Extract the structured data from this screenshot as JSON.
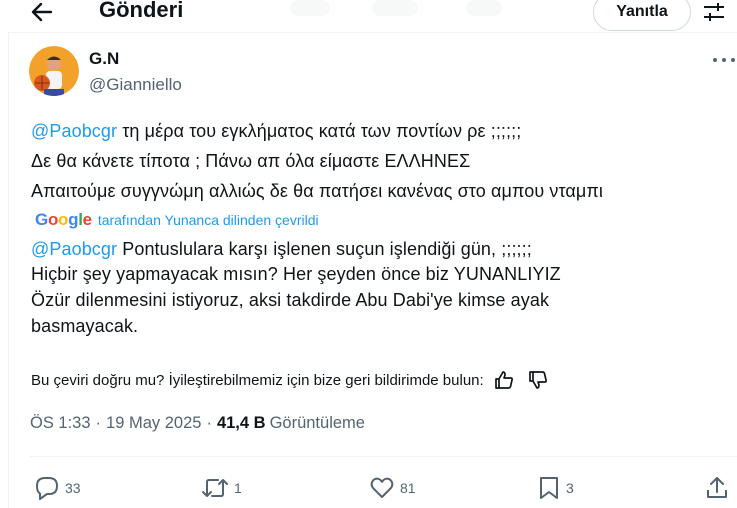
{
  "header": {
    "title": "Gönderi",
    "reply_label": "Yanıtla"
  },
  "author": {
    "display_name": "G.N",
    "handle": "@Gianniello"
  },
  "original": {
    "line1_mention": "@Paobcgr",
    "line1_text": " τη μέρα του εγκλήματος κατά των ποντίων ρε ;;;;;;",
    "line2": "Δε θα κάνετε τίποτα ; Πάνω απ όλα είμαστε ΕΛΛΗΝΕΣ",
    "line3": "Απαιτούμε συγγνώμη αλλιώς δε θα πατήσει κανένας στο αμπου νταμπι"
  },
  "translation": {
    "provider": "Google",
    "label": "tarafından Yunanca dilinden çevrildi",
    "line1_mention": "@Paobcgr",
    "line1_text": " Pontuslulara karşı işlenen suçun işlendiği gün, ;;;;;;",
    "line2": "Hiçbir şey yapmayacak mısın? Her şeyden önce biz YUNANLIYIZ",
    "line3": "Özür dilenmesini istiyoruz, aksi takdirde Abu Dabi'ye kimse ayak",
    "line4": "basmayacak.",
    "feedback": "Bu çeviri doğru mu? İyileştirebilmemiz için bize geri bildirimde bulun:"
  },
  "meta": {
    "time": "ÖS 1:33",
    "date": "19 May 2025",
    "views_count": "41,4 B",
    "views_label": "Görüntüleme",
    "separator": "·"
  },
  "actions": {
    "replies": "33",
    "reposts": "1",
    "likes": "81",
    "bookmarks": "3"
  },
  "icons": {
    "back": "arrow-left-icon",
    "settings": "sliders-icon",
    "more": "more-horizontal-icon",
    "reply": "speech-bubble-icon",
    "repost": "repost-icon",
    "like": "heart-icon",
    "bookmark": "bookmark-icon",
    "share": "share-icon",
    "thumbs_up": "thumbs-up-icon",
    "thumbs_down": "thumbs-down-icon"
  },
  "colors": {
    "accent": "#1d9bf0",
    "text": "#0f1419",
    "muted": "#536471",
    "border": "#eff3f4"
  }
}
